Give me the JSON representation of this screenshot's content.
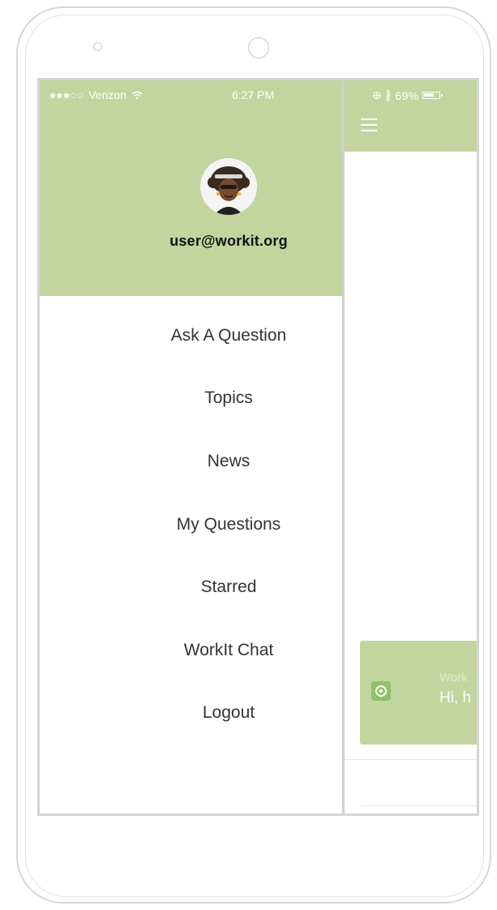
{
  "status_bar": {
    "signal": "●●●○○",
    "carrier": "Verizon",
    "time": "6:27 PM",
    "right_icons": "⊕ ∦",
    "battery_percent": "69%"
  },
  "drawer": {
    "user_email": "user@workit.org",
    "menu": [
      {
        "label": "Ask A Question"
      },
      {
        "label": "Topics"
      },
      {
        "label": "News"
      },
      {
        "label": "My Questions"
      },
      {
        "label": "Starred"
      },
      {
        "label": "WorkIt Chat"
      },
      {
        "label": "Logout"
      }
    ]
  },
  "main": {
    "chat_card": {
      "sender": "Work",
      "message": "Hi, h"
    }
  },
  "colors": {
    "header_green": "#c2d59e",
    "drawer_background": "#ffffff",
    "menu_text": "#333333"
  }
}
